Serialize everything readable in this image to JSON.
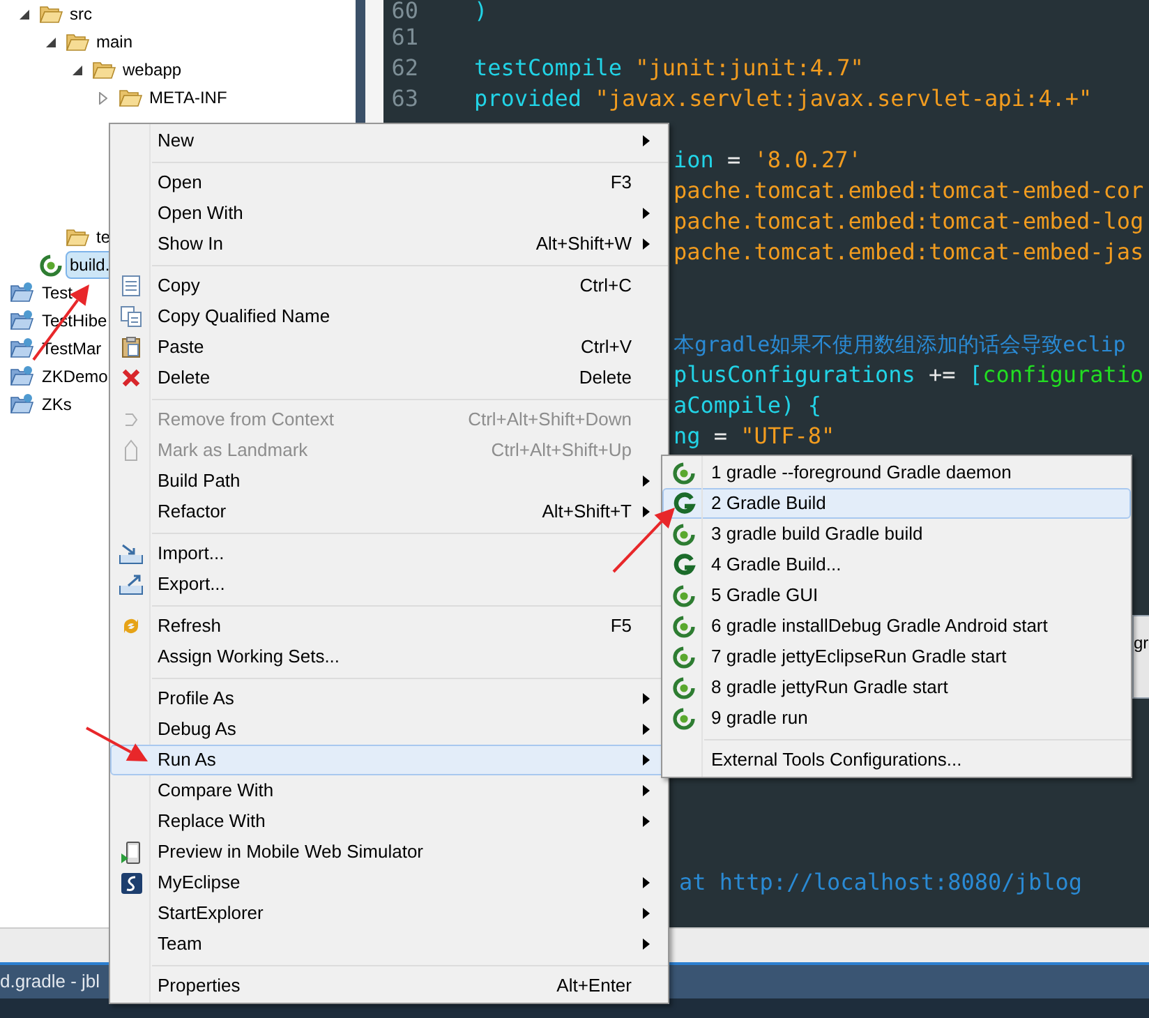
{
  "tree": {
    "open_project_children": [
      {
        "label": "src",
        "kind": "folder",
        "expanded": true,
        "selected": false,
        "children": [
          {
            "label": "main",
            "kind": "folder",
            "expanded": true,
            "selected": false,
            "children": [
              {
                "label": "webapp",
                "kind": "folder",
                "expanded": true,
                "selected": false,
                "children": [
                  {
                    "label": "META-INF",
                    "kind": "folder",
                    "expanded": false,
                    "selected": false
                  }
                ]
              }
            ]
          },
          {
            "label": "te",
            "kind": "folder",
            "selected": false
          }
        ]
      },
      {
        "label": "build.",
        "kind": "gradle-file",
        "selected": true
      }
    ],
    "projects": [
      {
        "label": "Test",
        "kind": "project",
        "selected": false
      },
      {
        "label": "TestHibe",
        "kind": "project",
        "selected": false
      },
      {
        "label": "TestMar",
        "kind": "project",
        "selected": false
      },
      {
        "label": "ZKDemo",
        "kind": "project",
        "selected": false
      },
      {
        "label": "ZKs",
        "kind": "project",
        "selected": false
      }
    ]
  },
  "editor": {
    "lines": [
      {
        "number": "60",
        "segments": [
          {
            "kind": "keyword",
            "text": ")"
          }
        ]
      },
      {
        "number": "61"
      },
      {
        "number": "62",
        "segments": [
          {
            "kind": "keyword",
            "text": "testCompile "
          },
          {
            "kind": "string",
            "text": "\"junit:junit:4.7\""
          }
        ]
      },
      {
        "number": "63",
        "segments": [
          {
            "kind": "keyword",
            "text": "provided "
          },
          {
            "kind": "string",
            "text": "\"javax.servlet:javax.servlet-api:4.+\""
          }
        ]
      }
    ],
    "partial_lines": [
      {
        "segments": [
          {
            "kind": "keyword",
            "text": "ion "
          },
          {
            "kind": "operator",
            "text": "= "
          },
          {
            "kind": "string",
            "text": "'8.0.27'"
          }
        ]
      },
      {
        "segments": [
          {
            "kind": "string",
            "text": "pache.tomcat.embed:tomcat-embed-cor"
          }
        ]
      },
      {
        "segments": [
          {
            "kind": "string",
            "text": "pache.tomcat.embed:tomcat-embed-log"
          }
        ]
      },
      {
        "segments": [
          {
            "kind": "string",
            "text": "pache.tomcat.embed:tomcat-embed-jas"
          }
        ]
      },
      {
        "segments": [
          {
            "kind": "comment",
            "text": "本gradle如果不使用数组添加的话会导致eclip"
          }
        ]
      },
      {
        "segments": [
          {
            "kind": "keyword",
            "text": "plusConfigurations "
          },
          {
            "kind": "operator",
            "text": "+= "
          },
          {
            "kind": "keyword",
            "text": "["
          },
          {
            "kind": "identifier",
            "text": "configuratio"
          }
        ]
      },
      {
        "segments": [
          {
            "kind": "keyword",
            "text": "aCompile) {"
          }
        ]
      },
      {
        "segments": [
          {
            "kind": "keyword",
            "text": "ng "
          },
          {
            "kind": "operator",
            "text": "= "
          },
          {
            "kind": "string",
            "text": "\"UTF-8\""
          }
        ]
      }
    ],
    "lower_fragment": {
      "segments": [
        {
          "kind": "comment",
          "text": "at http://localhost:8080/jblog"
        }
      ]
    },
    "side_panel_fragment": "gr"
  },
  "context_menu": {
    "groups": [
      {
        "items": [
          {
            "label": "New",
            "has_submenu": true,
            "disabled": false,
            "selected": false
          }
        ]
      },
      {
        "items": [
          {
            "label": "Open",
            "shortcut": "F3",
            "has_submenu": false,
            "disabled": false,
            "selected": false
          },
          {
            "label": "Open With",
            "has_submenu": true,
            "disabled": false,
            "selected": false
          },
          {
            "label": "Show In",
            "shortcut": "Alt+Shift+W",
            "has_submenu": true,
            "disabled": false,
            "selected": false
          }
        ]
      },
      {
        "items": [
          {
            "label": "Copy",
            "shortcut": "Ctrl+C",
            "has_submenu": false,
            "disabled": false,
            "selected": false
          },
          {
            "label": "Copy Qualified Name",
            "has_submenu": false,
            "disabled": false,
            "selected": false
          },
          {
            "label": "Paste",
            "shortcut": "Ctrl+V",
            "has_submenu": false,
            "disabled": false,
            "selected": false
          },
          {
            "label": "Delete",
            "shortcut": "Delete",
            "has_submenu": false,
            "disabled": false,
            "selected": false
          }
        ]
      },
      {
        "items": [
          {
            "label": "Remove from Context",
            "shortcut": "Ctrl+Alt+Shift+Down",
            "has_submenu": false,
            "disabled": true,
            "selected": false
          },
          {
            "label": "Mark as Landmark",
            "shortcut": "Ctrl+Alt+Shift+Up",
            "has_submenu": false,
            "disabled": true,
            "selected": false
          },
          {
            "label": "Build Path",
            "has_submenu": true,
            "disabled": false,
            "selected": false
          },
          {
            "label": "Refactor",
            "shortcut": "Alt+Shift+T",
            "has_submenu": true,
            "disabled": false,
            "selected": false
          }
        ]
      },
      {
        "items": [
          {
            "label": "Import...",
            "has_submenu": false,
            "disabled": false,
            "selected": false
          },
          {
            "label": "Export...",
            "has_submenu": false,
            "disabled": false,
            "selected": false
          }
        ]
      },
      {
        "items": [
          {
            "label": "Refresh",
            "shortcut": "F5",
            "has_submenu": false,
            "disabled": false,
            "selected": false
          },
          {
            "label": "Assign Working Sets...",
            "has_submenu": false,
            "disabled": false,
            "selected": false
          }
        ]
      },
      {
        "items": [
          {
            "label": "Profile As",
            "has_submenu": true,
            "disabled": false,
            "selected": false
          },
          {
            "label": "Debug As",
            "has_submenu": true,
            "disabled": false,
            "selected": false
          },
          {
            "label": "Run As",
            "has_submenu": true,
            "disabled": false,
            "selected": true
          },
          {
            "label": "Compare With",
            "has_submenu": true,
            "disabled": false,
            "selected": false
          },
          {
            "label": "Replace With",
            "has_submenu": true,
            "disabled": false,
            "selected": false
          },
          {
            "label": "Preview in Mobile Web Simulator",
            "has_submenu": false,
            "disabled": false,
            "selected": false
          },
          {
            "label": "MyEclipse",
            "has_submenu": true,
            "disabled": false,
            "selected": false
          },
          {
            "label": "StartExplorer",
            "has_submenu": true,
            "disabled": false,
            "selected": false
          },
          {
            "label": "Team",
            "has_submenu": true,
            "disabled": false,
            "selected": false
          }
        ]
      },
      {
        "items": [
          {
            "label": "Properties",
            "shortcut": "Alt+Enter",
            "has_submenu": false,
            "disabled": false,
            "selected": false
          }
        ]
      }
    ]
  },
  "run_as_submenu": {
    "groups": [
      {
        "items": [
          {
            "label": "1 gradle --foreground Gradle daemon",
            "kind": "gradle-ring",
            "selected": false
          },
          {
            "label": "2 Gradle Build",
            "kind": "gradle-g",
            "selected": true
          },
          {
            "label": "3 gradle build Gradle build",
            "kind": "gradle-ring",
            "selected": false
          },
          {
            "label": "4 Gradle Build...",
            "kind": "gradle-g",
            "selected": false
          },
          {
            "label": "5 Gradle GUI",
            "kind": "gradle-ring",
            "selected": false
          },
          {
            "label": "6 gradle installDebug Gradle Android start",
            "kind": "gradle-ring",
            "selected": false
          },
          {
            "label": "7 gradle jettyEclipseRun Gradle start",
            "kind": "gradle-ring",
            "selected": false
          },
          {
            "label": "8 gradle jettyRun Gradle start",
            "kind": "gradle-ring",
            "selected": false
          },
          {
            "label": "9 gradle run",
            "kind": "gradle-ring",
            "selected": false
          }
        ]
      },
      {
        "items": [
          {
            "label": "External Tools Configurations...",
            "selected": false
          }
        ]
      }
    ]
  },
  "status_bar": {
    "title": "d.gradle - jbl"
  }
}
